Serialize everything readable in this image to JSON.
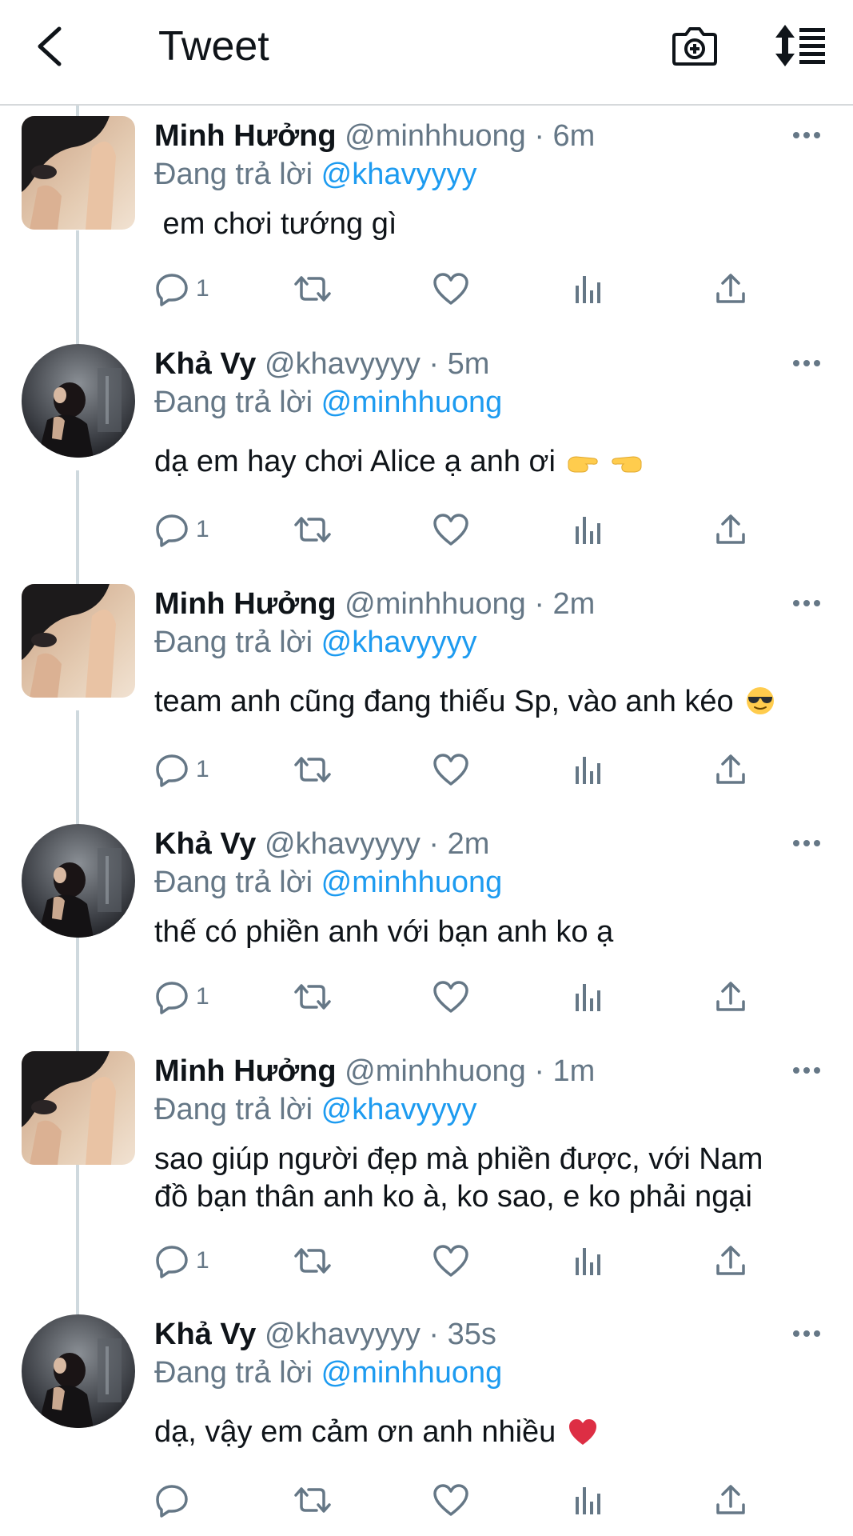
{
  "header": {
    "title": "Tweet",
    "back_icon": "chevron-left-icon",
    "camera_icon": "camera-add-icon",
    "sort_icon": "sort-list-icon"
  },
  "colors": {
    "link": "#1d9bf0",
    "secondary_text": "#657786",
    "primary_text": "#0f1419",
    "thread_line": "#cfd9de",
    "divider": "#d6d9db"
  },
  "tweets": [
    {
      "name": "Minh Hưởng",
      "meta": "@minhhuong · 6m",
      "reply_prefix": "Đang trả lời",
      "reply_to": "@khavyyyy",
      "text": " em chơi tướng gì",
      "emojis": [],
      "reply_count": "1",
      "avatar_style": "square"
    },
    {
      "name": "Khả Vy",
      "meta": "@khavyyyy · 5m",
      "reply_prefix": "Đang trả lời",
      "reply_to": "@minhhuong",
      "text": "dạ em hay chơi Alice ạ anh ơi",
      "emojis": [
        "pointing-right-emoji",
        "pointing-left-emoji"
      ],
      "reply_count": "1",
      "avatar_style": "round"
    },
    {
      "name": "Minh Hưởng",
      "meta": "@minhhuong · 2m",
      "reply_prefix": "Đang trả lời",
      "reply_to": "@khavyyyy",
      "text": "team anh cũng đang thiếu Sp, vào anh kéo",
      "emojis": [
        "sunglasses-emoji"
      ],
      "reply_count": "1",
      "avatar_style": "square"
    },
    {
      "name": "Khả Vy",
      "meta": "@khavyyyy · 2m",
      "reply_prefix": "Đang trả lời",
      "reply_to": "@minhhuong",
      "text": "thế có phiền anh với bạn anh ko ạ",
      "emojis": [],
      "reply_count": "1",
      "avatar_style": "round"
    },
    {
      "name": "Minh Hưởng",
      "meta": "@minhhuong · 1m",
      "reply_prefix": "Đang trả lời",
      "reply_to": "@khavyyyy",
      "text_lines": [
        "sao giúp người đẹp mà phiền được, với Nam",
        "đồ bạn thân anh ko à, ko sao, e ko phải ngại"
      ],
      "emojis": [],
      "reply_count": "1",
      "avatar_style": "square"
    },
    {
      "name": "Khả Vy",
      "meta": "@khavyyyy · 35s",
      "reply_prefix": "Đang trả lời",
      "reply_to": "@minhhuong",
      "text": "dạ, vậy em cảm ơn anh nhiều",
      "emojis": [
        "red-heart-emoji"
      ],
      "reply_count": "",
      "avatar_style": "round"
    }
  ]
}
